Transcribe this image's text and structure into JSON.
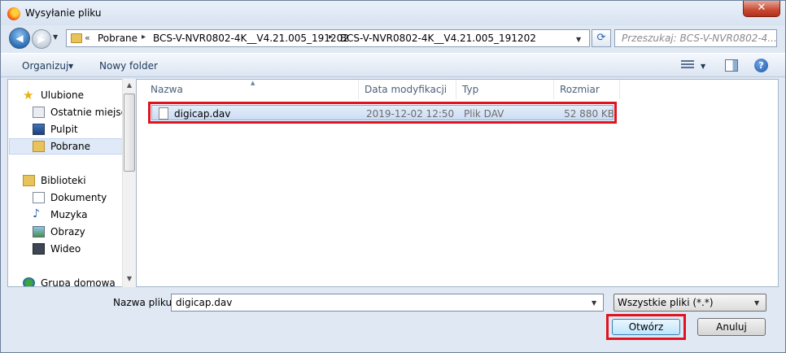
{
  "window": {
    "title": "Wysyłanie pliku",
    "close_label": "✕"
  },
  "nav": {
    "back_label": "◀",
    "forward_label": "▶",
    "breadcrumb_prefix": "«",
    "breadcrumbs": [
      "Pobrane",
      "BCS-V-NVR0802-4K__V4.21.005_191202",
      "BCS-V-NVR0802-4K__V4.21.005_191202"
    ],
    "separator": "▸",
    "refresh_label": "⟳",
    "search_placeholder": "Przeszukaj: BCS-V-NVR0802-4..."
  },
  "toolbar": {
    "organize_label": "Organizuj",
    "new_folder_label": "Nowy folder",
    "help_label": "?"
  },
  "sidebar": {
    "favorites": {
      "label": "Ulubione",
      "items": [
        "Ostatnie miejsca",
        "Pulpit",
        "Pobrane"
      ]
    },
    "libraries": {
      "label": "Biblioteki",
      "items": [
        "Dokumenty",
        "Muzyka",
        "Obrazy",
        "Wideo"
      ]
    },
    "homegroup": {
      "label": "Grupa domowa"
    },
    "selected": "Pobrane"
  },
  "file_list": {
    "columns": [
      "Nazwa",
      "Data modyfikacji",
      "Typ",
      "Rozmiar"
    ],
    "rows": [
      {
        "name": "digicap.dav",
        "modified": "2019-12-02 12:50",
        "type": "Plik DAV",
        "size": "52 880 KB"
      }
    ]
  },
  "footer": {
    "filename_label": "Nazwa pliku:",
    "filename_value": "digicap.dav",
    "filter_value": "Wszystkie pliki (*.*)",
    "open_label": "Otwórz",
    "cancel_label": "Anuluj"
  },
  "colors": {
    "highlight_box": "#e0141e",
    "selection": "#cbdcf3",
    "accent": "#2667b3"
  },
  "icons": [
    "firefox-icon",
    "back-arrow-icon",
    "forward-arrow-icon",
    "folder-icon",
    "refresh-icon",
    "search-icon",
    "view-icon",
    "preview-pane-icon",
    "help-icon",
    "star-icon",
    "recent-places-icon",
    "desktop-icon",
    "downloads-icon",
    "libraries-icon",
    "documents-icon",
    "music-icon",
    "pictures-icon",
    "video-icon",
    "homegroup-icon",
    "file-icon"
  ]
}
